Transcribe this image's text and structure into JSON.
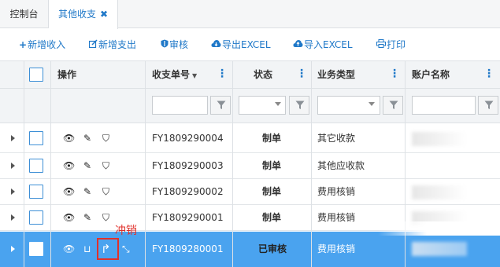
{
  "tabs": [
    {
      "label": "控制台"
    },
    {
      "label": "其他收支",
      "close": "✖"
    }
  ],
  "toolbar": {
    "add_income": "新增收入",
    "add_expense": "新增支出",
    "audit": "审核",
    "export": "导出EXCEL",
    "import": "导入EXCEL",
    "print": "打印"
  },
  "columns": {
    "ops": "操作",
    "doc_no": "收支单号",
    "status": "状态",
    "biz_type": "业务类型",
    "account": "账户名称"
  },
  "rows": [
    {
      "doc_no": "FY1809290004",
      "status": "制单",
      "biz_type": "其它收款"
    },
    {
      "doc_no": "FY1809290003",
      "status": "制单",
      "biz_type": "其他应收款"
    },
    {
      "doc_no": "FY1809290002",
      "status": "制单",
      "biz_type": "费用核销"
    },
    {
      "doc_no": "FY1809290001",
      "status": "制单",
      "biz_type": "费用核销"
    },
    {
      "doc_no": "FY1809280001",
      "status": "已审核",
      "biz_type": "费用核销"
    }
  ],
  "annotation": {
    "label": "冲销",
    "color": "#e0312b"
  },
  "colors": {
    "accent": "#1f78c8",
    "selected_row": "#4aa3ef"
  }
}
